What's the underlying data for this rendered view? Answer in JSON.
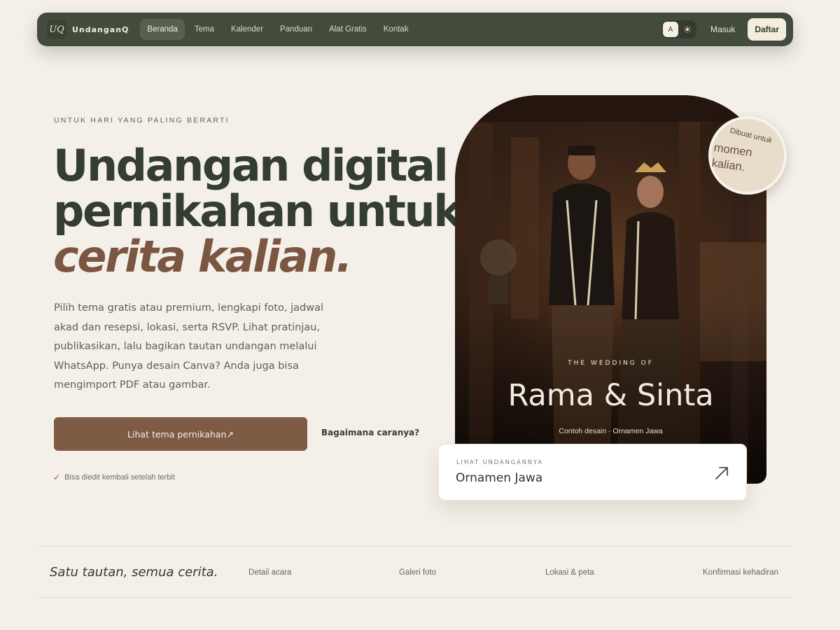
{
  "nav": {
    "logo_mark": "UQ",
    "brand": "UndanganQ",
    "links": [
      {
        "label": "Beranda",
        "active": true
      },
      {
        "label": "Tema",
        "active": false
      },
      {
        "label": "Kalender",
        "active": false
      },
      {
        "label": "Panduan",
        "active": false
      },
      {
        "label": "Alat Gratis",
        "active": false
      },
      {
        "label": "Kontak",
        "active": false
      }
    ],
    "theme_toggle": {
      "text_option": "A",
      "icon_option": "sun-icon"
    },
    "login": "Masuk",
    "signup": "Daftar"
  },
  "hero": {
    "eyebrow": "UNTUK HARI YANG PALING BERARTI",
    "headline_line1": "Undangan digital",
    "headline_line2": "pernikahan untuk",
    "headline_accent": "cerita kalian.",
    "lead": "Pilih tema gratis atau premium, lengkapi foto, jadwal akad dan resepsi, lokasi, serta RSVP. Lihat pratinjau, publikasikan, lalu bagikan tautan undangan melalui WhatsApp. Punya desain Canva? Anda juga bisa mengimport PDF atau gambar.",
    "cta_primary": "Lihat tema pernikahan↗",
    "cta_secondary": "Bagaimana caranya?",
    "note": "Bisa diedit kembali setelah terbit"
  },
  "card": {
    "eyebrow": "THE WEDDING OF",
    "names": "Rama & Sinta",
    "caption": "Contoh desain · Ornamen Jawa",
    "badge_small": "Dibuat untuk",
    "badge_big": "momen kalian.",
    "preview_eyebrow": "LIHAT UNDANGANNYA",
    "preview_title": "Ornamen Jawa"
  },
  "strip": {
    "tagline": "Satu tautan, semua cerita.",
    "features": [
      "Detail acara",
      "Galeri foto",
      "Lokasi & peta",
      "Konfirmasi kehadiran"
    ]
  },
  "colors": {
    "nav_bg": "#434c3c",
    "page_bg": "#f4f0e9",
    "accent_brown": "#7e5b44",
    "heading_green": "#343d32"
  }
}
